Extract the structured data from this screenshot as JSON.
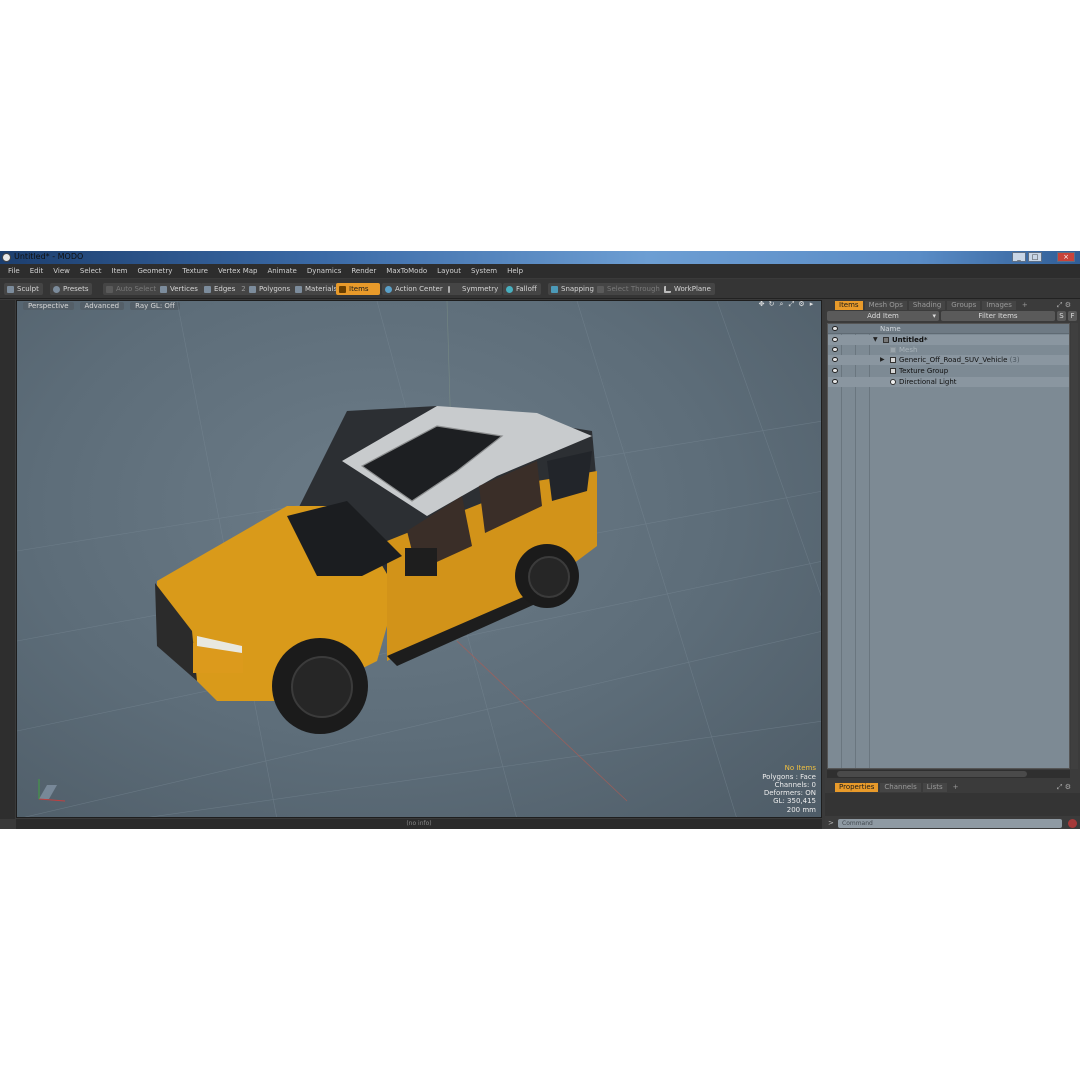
{
  "window": {
    "title": "Untitled* - MODO",
    "controls": [
      "_",
      "□",
      "×"
    ]
  },
  "menu": [
    "File",
    "Edit",
    "View",
    "Select",
    "Item",
    "Geometry",
    "Texture",
    "Vertex Map",
    "Animate",
    "Dynamics",
    "Render",
    "MaxToModo",
    "Layout",
    "System",
    "Help"
  ],
  "toolbar": {
    "sculpt": "Sculpt",
    "presets": "Presets",
    "auto_select": "Auto Select",
    "vertices": "Vertices",
    "edges": "Edges",
    "edges_count": "2",
    "polygons": "Polygons",
    "materials": "Materials",
    "items": "Items",
    "action_center": "Action Center",
    "symmetry": "Symmetry",
    "falloff": "Falloff",
    "snapping": "Snapping",
    "select_through": "Select Through",
    "workplane": "WorkPlane"
  },
  "viewport": {
    "tabs": [
      "Perspective",
      "Advanced",
      "Ray GL: Off"
    ],
    "stats": {
      "items": "No Items",
      "polygons": "Polygons : Face",
      "channels": "Channels: 0",
      "deformers": "Deformers: ON",
      "gl": "GL: 350,415",
      "scale": "200 mm"
    },
    "footer": "(no info)"
  },
  "panel": {
    "tabs": [
      "Items",
      "Mesh Ops",
      "Shading",
      "Groups",
      "Images",
      "+"
    ],
    "add_item": "Add Item",
    "filter_items": "Filter Items",
    "filter_s": "S",
    "filter_f": "F",
    "column_name": "Name",
    "tree": {
      "root": "Untitled*",
      "mesh": "Mesh",
      "vehicle": "Generic_Off_Road_SUV_Vehicle",
      "vehicle_count": "(3)",
      "texture_group": "Texture Group",
      "light": "Directional Light"
    },
    "prop_tabs": [
      "Properties",
      "Channels",
      "Lists",
      "+"
    ],
    "command_prompt": ">",
    "command_placeholder": "Command"
  },
  "colors": {
    "accent": "#e89a2a",
    "viewport": "#5d6d79",
    "vehicle_body": "#d99a1a"
  }
}
